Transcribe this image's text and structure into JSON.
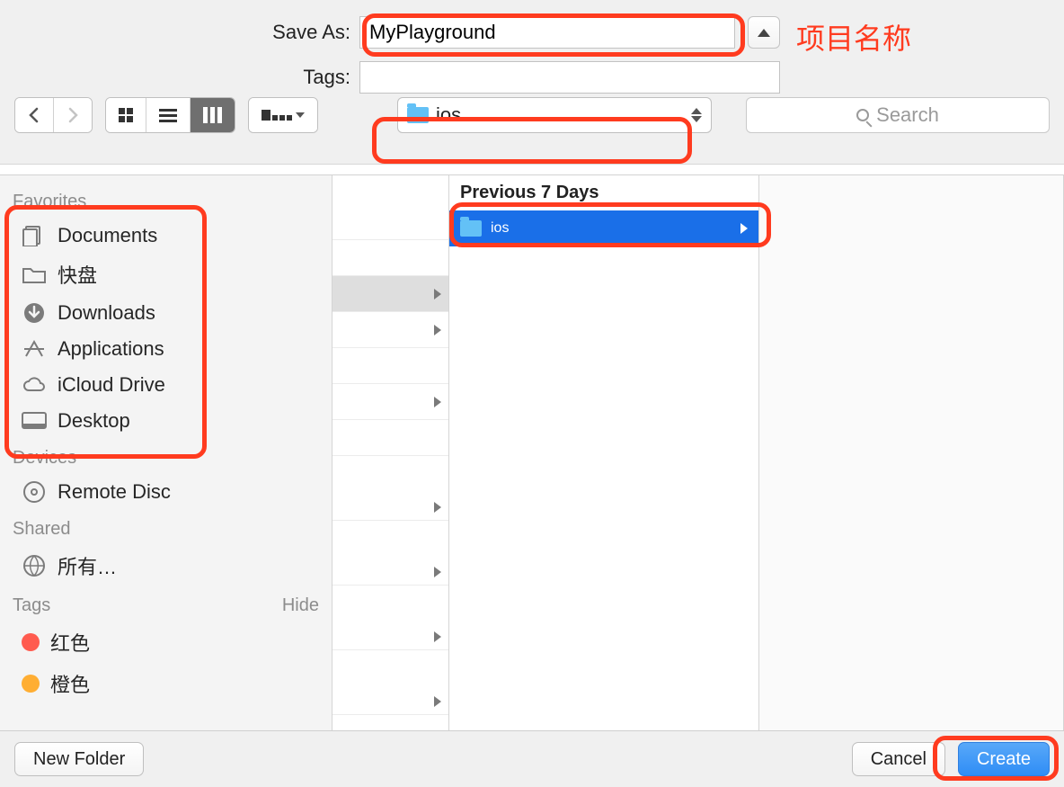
{
  "form": {
    "save_as_label": "Save As:",
    "save_as_value": "MyPlayground",
    "tags_label": "Tags:",
    "tags_value": ""
  },
  "toolbar": {
    "location_name": "ios",
    "search_placeholder": "Search"
  },
  "sidebar": {
    "favorites_header": "Favorites",
    "favorites": [
      {
        "icon": "documents",
        "label": "Documents"
      },
      {
        "icon": "folder",
        "label": "快盘"
      },
      {
        "icon": "downloads",
        "label": "Downloads"
      },
      {
        "icon": "apps",
        "label": "Applications"
      },
      {
        "icon": "icloud",
        "label": "iCloud Drive"
      },
      {
        "icon": "desktop",
        "label": "Desktop"
      }
    ],
    "devices_header": "Devices",
    "devices": [
      {
        "icon": "disc",
        "label": "Remote Disc"
      }
    ],
    "shared_header": "Shared",
    "shared": [
      {
        "icon": "globe",
        "label": "所有…"
      }
    ],
    "tags_header": "Tags",
    "tags_hide": "Hide",
    "tags": [
      {
        "color": "#ff5b4f",
        "label": "红色"
      },
      {
        "color": "#ffae33",
        "label": "橙色"
      }
    ]
  },
  "browser": {
    "section_header": "Previous 7 Days",
    "selected_item": "ios"
  },
  "footer": {
    "new_folder": "New Folder",
    "cancel": "Cancel",
    "create": "Create"
  },
  "annotations": {
    "project_name": "项目名称"
  }
}
